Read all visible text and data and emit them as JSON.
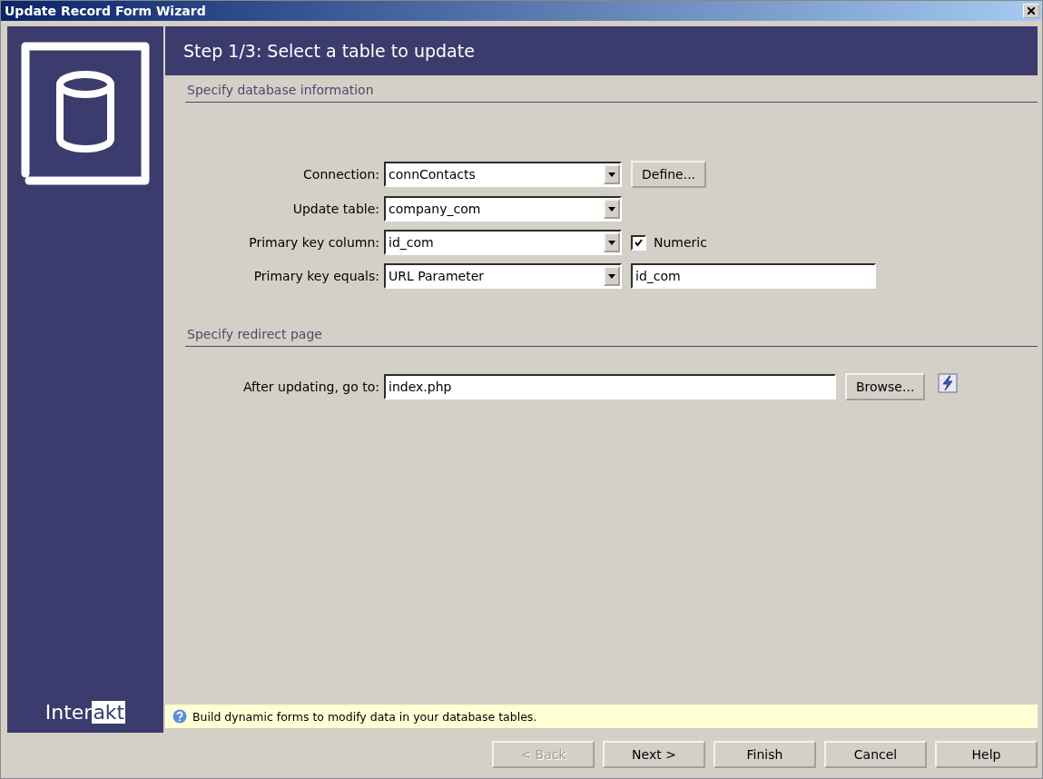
{
  "window": {
    "title": "Update Record Form Wizard"
  },
  "sidebar": {
    "logo": [
      "Inter",
      "akt"
    ]
  },
  "step_title": "Step 1/3: Select a table to update",
  "sections": [
    {
      "title": "Specify database information",
      "rows": [
        {
          "label": "Connection:",
          "fields": [
            {
              "kind": "select",
              "value": "connContacts"
            },
            {
              "kind": "button",
              "label": "Define..."
            }
          ]
        },
        {
          "label": "Update table:",
          "fields": [
            {
              "kind": "select",
              "value": "company_com"
            }
          ]
        },
        {
          "label": "Primary key column:",
          "fields": [
            {
              "kind": "select",
              "value": "id_com"
            },
            {
              "kind": "checkbox",
              "label": "Numeric",
              "checked": true
            }
          ]
        },
        {
          "label": "Primary key equals:",
          "fields": [
            {
              "kind": "select",
              "value": "URL Parameter"
            },
            {
              "kind": "text",
              "value": "id_com"
            }
          ]
        }
      ]
    },
    {
      "title": "Specify redirect page",
      "rows": [
        {
          "label": "After updating, go to:",
          "fields": [
            {
              "kind": "text",
              "value": "index.php"
            },
            {
              "kind": "button",
              "label": "Browse..."
            },
            {
              "kind": "dynamic"
            }
          ]
        }
      ]
    }
  ],
  "hint": {
    "text": "Build dynamic forms to modify data in your database tables."
  },
  "buttons": [
    {
      "label": "< Back",
      "disabled": true
    },
    {
      "label": "Next >",
      "disabled": false
    },
    {
      "label": "Finish",
      "disabled": false
    },
    {
      "label": "Cancel",
      "disabled": false
    },
    {
      "label": "Help",
      "disabled": false
    }
  ]
}
